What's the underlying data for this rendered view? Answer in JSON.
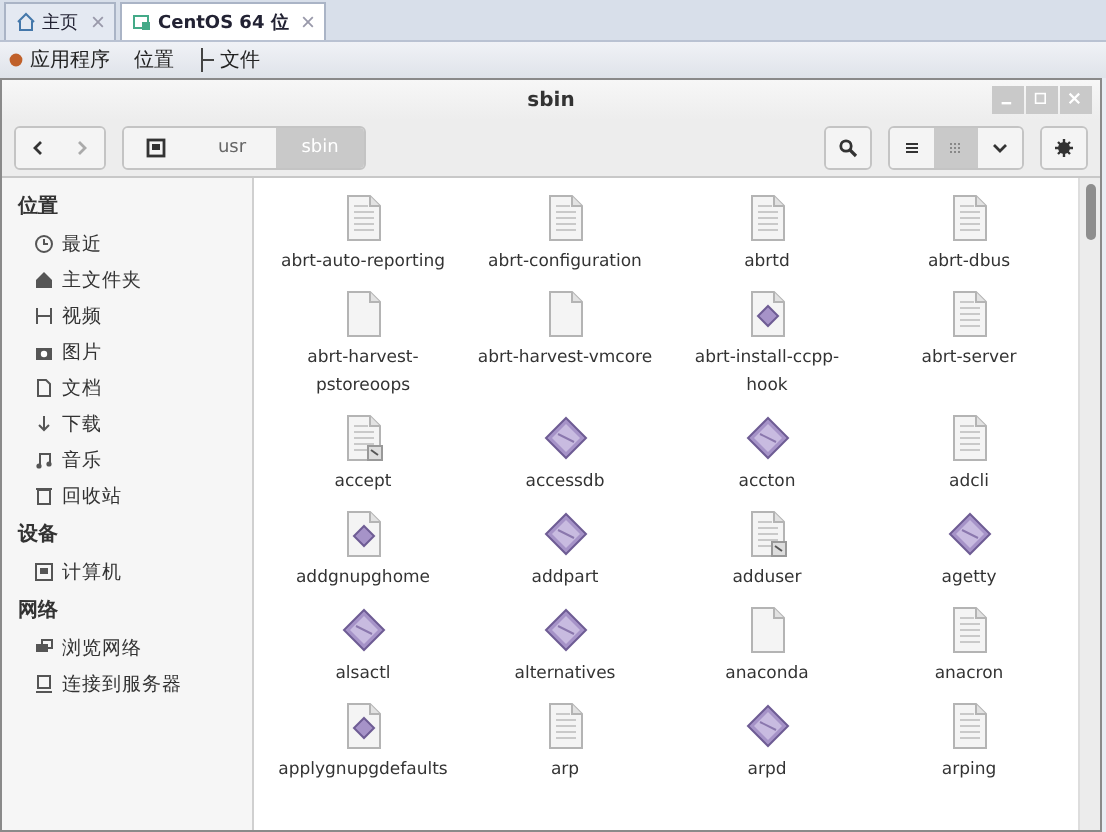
{
  "vm_tabs": [
    {
      "label": "主页",
      "kind": "home",
      "selected": false
    },
    {
      "label": "CentOS 64 位",
      "kind": "vm",
      "selected": true
    }
  ],
  "menu_bar": [
    {
      "label": "应用程序",
      "kind": "apps"
    },
    {
      "label": "位置",
      "kind": "plain"
    },
    {
      "label": "文件",
      "kind": "drag"
    }
  ],
  "window": {
    "title": "sbin"
  },
  "path_bar": [
    {
      "kind": "root",
      "selected": false
    },
    {
      "label": "usr",
      "kind": "folder",
      "selected": false
    },
    {
      "label": "sbin",
      "kind": "folder",
      "selected": true
    }
  ],
  "view_buttons": [
    {
      "kind": "list",
      "selected": false
    },
    {
      "kind": "grid",
      "selected": true
    },
    {
      "kind": "menu",
      "selected": false
    }
  ],
  "sidebar": [
    {
      "heading": "位置",
      "items": [
        {
          "label": "最近",
          "kind": "recent"
        },
        {
          "label": "主文件夹",
          "kind": "home"
        },
        {
          "label": "视频",
          "kind": "video"
        },
        {
          "label": "图片",
          "kind": "camera"
        },
        {
          "label": "文档",
          "kind": "doc"
        },
        {
          "label": "下载",
          "kind": "download"
        },
        {
          "label": "音乐",
          "kind": "music"
        },
        {
          "label": "回收站",
          "kind": "trash"
        }
      ]
    },
    {
      "heading": "设备",
      "items": [
        {
          "label": "计算机",
          "kind": "computer"
        }
      ]
    },
    {
      "heading": "网络",
      "items": [
        {
          "label": "浏览网络",
          "kind": "network"
        },
        {
          "label": "连接到服务器",
          "kind": "server"
        }
      ]
    }
  ],
  "files": [
    {
      "name": "abrt-auto-reporting",
      "kind": "text"
    },
    {
      "name": "abrt-configuration",
      "kind": "text"
    },
    {
      "name": "abrtd",
      "kind": "text"
    },
    {
      "name": "abrt-dbus",
      "kind": "text"
    },
    {
      "name": "abrt-harvest-pstoreoops",
      "kind": "blank"
    },
    {
      "name": "abrt-harvest-vmcore",
      "kind": "blank"
    },
    {
      "name": "abrt-install-ccpp-hook",
      "kind": "script"
    },
    {
      "name": "abrt-server",
      "kind": "text"
    },
    {
      "name": "accept",
      "kind": "link"
    },
    {
      "name": "accessdb",
      "kind": "exec"
    },
    {
      "name": "accton",
      "kind": "exec"
    },
    {
      "name": "adcli",
      "kind": "text"
    },
    {
      "name": "addgnupghome",
      "kind": "script"
    },
    {
      "name": "addpart",
      "kind": "exec"
    },
    {
      "name": "adduser",
      "kind": "link"
    },
    {
      "name": "agetty",
      "kind": "exec"
    },
    {
      "name": "alsactl",
      "kind": "exec"
    },
    {
      "name": "alternatives",
      "kind": "exec"
    },
    {
      "name": "anaconda",
      "kind": "blank"
    },
    {
      "name": "anacron",
      "kind": "text"
    },
    {
      "name": "applygnupgdefaults",
      "kind": "script"
    },
    {
      "name": "arp",
      "kind": "text"
    },
    {
      "name": "arpd",
      "kind": "exec"
    },
    {
      "name": "arping",
      "kind": "text"
    }
  ]
}
